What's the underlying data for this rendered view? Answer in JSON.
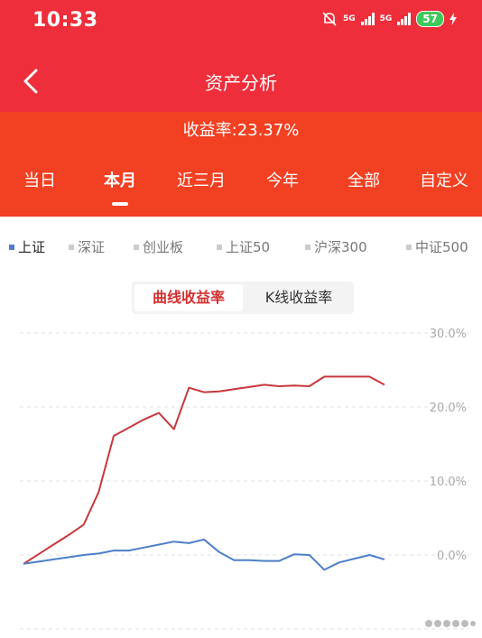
{
  "status": {
    "time": "10:33",
    "net1": "5G",
    "net2": "5G",
    "battery": "57"
  },
  "header": {
    "title": "资产分析"
  },
  "summary": {
    "yield_text": "收益率:23.37%"
  },
  "tabs": [
    {
      "label": "当日",
      "active": false
    },
    {
      "label": "本月",
      "active": true
    },
    {
      "label": "近三月",
      "active": false
    },
    {
      "label": "今年",
      "active": false
    },
    {
      "label": "全部",
      "active": false
    },
    {
      "label": "自定义",
      "active": false
    }
  ],
  "benchmarks": [
    {
      "label": "上证",
      "active": true
    },
    {
      "label": "深证",
      "active": false
    },
    {
      "label": "创业板",
      "active": false
    },
    {
      "label": "上证50",
      "active": false
    },
    {
      "label": "沪深300",
      "active": false
    },
    {
      "label": "中证500",
      "active": false
    }
  ],
  "toggle": {
    "curve_label": "曲线收益率",
    "kline_label": "K线收益率"
  },
  "colors": {
    "header_red": "#ee2e3a",
    "tab_orange": "#f24022",
    "series_red": "#c8383b",
    "series_blue": "#4d7fc8"
  },
  "chart_data": {
    "type": "line",
    "x": [
      0,
      1,
      2,
      3,
      4,
      5,
      6,
      7,
      8,
      9,
      10,
      11,
      12,
      13,
      14,
      15,
      16,
      17,
      18,
      19,
      20,
      21,
      22,
      23,
      24,
      25,
      26,
      27
    ],
    "series": [
      {
        "values": [
          -1.2,
          0.1,
          1.4,
          2.7,
          4.1,
          8.5,
          16.1,
          17.2,
          18.3,
          19.2,
          17.0,
          22.6,
          22.0,
          22.1,
          22.4,
          22.7,
          23.0,
          22.8,
          22.9,
          22.8,
          24.1,
          24.1,
          24.1,
          24.1,
          23.0
        ]
      },
      {
        "values": [
          -1.2,
          -0.9,
          -0.6,
          -0.3,
          0.0,
          0.2,
          0.6,
          0.6,
          1.0,
          1.4,
          1.8,
          1.6,
          2.1,
          0.4,
          -0.7,
          -0.7,
          -0.8,
          -0.8,
          0.1,
          0.0,
          -2.0,
          -1.0,
          -0.5,
          0.0,
          -0.6
        ]
      }
    ],
    "ylim": [
      -10,
      30
    ],
    "yticks": [
      "30.0%",
      "20.0%",
      "10.0%",
      "0.0%"
    ],
    "grid": true
  }
}
